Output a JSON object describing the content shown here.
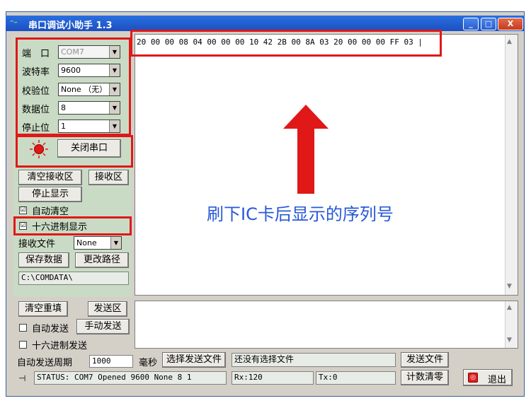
{
  "window": {
    "title": "串口调试小助手 1.3",
    "app_icon": "serial-app-icon",
    "minimize": "_",
    "maximize": "□",
    "close": "X"
  },
  "settings": {
    "port_label": "端　口",
    "port_value": "COM7",
    "baud_label": "波特率",
    "baud_value": "9600",
    "parity_label": "校验位",
    "parity_value": "None （无）",
    "databits_label": "数据位",
    "databits_value": "8",
    "stopbits_label": "停止位",
    "stopbits_value": "1"
  },
  "port_toggle": {
    "indicator_color": "#e01818",
    "label": "关闭串口"
  },
  "receive_controls": {
    "clear_receive": "清空接收区",
    "receive_area": "接收区",
    "stop_display": "停止显示",
    "auto_clear": "自动清空",
    "auto_clear_checked": "☑",
    "hex_display": "十六进制显示",
    "hex_display_checked": "☑",
    "receive_file_label": "接收文件",
    "receive_file_value": "None",
    "save_data": "保存数据",
    "change_path": "更改路径",
    "path": "C:\\COMDATA\\"
  },
  "receive": {
    "content": "20 00 00 08 04 00 00 00 10 42 2B 00 8A 03 20 00 00 00 FF 03 |"
  },
  "annotation": {
    "text": "刷下IC卡后显示的序列号",
    "color": "#2858d8",
    "arrow_color": "#e01818"
  },
  "send_controls": {
    "clear_refill": "清空重填",
    "send_area": "发送区",
    "auto_send": "自动发送",
    "manual_send": "手动发送",
    "hex_send": "十六进制发送",
    "period_label": "自动发送周期",
    "period_value": "1000",
    "ms_label": "毫秒",
    "select_file": "选择发送文件",
    "no_file": "还没有选择文件",
    "send_file": "发送文件",
    "reset_count": "计数清零",
    "exit": "退出"
  },
  "status": {
    "text": "STATUS: COM7 Opened 9600 None  8 1",
    "rx": "Rx:120",
    "tx": "Tx:0"
  }
}
